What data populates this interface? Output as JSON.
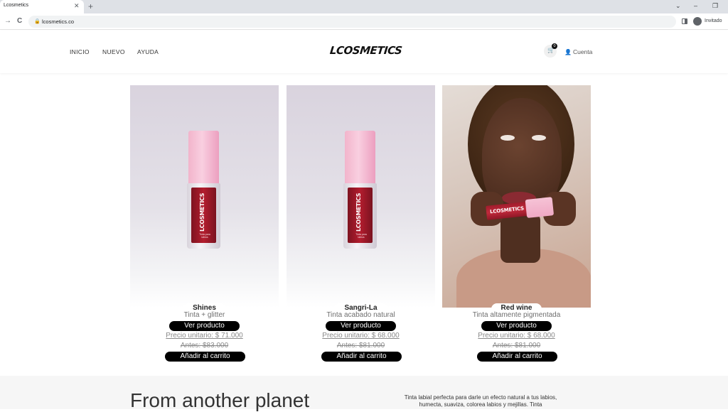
{
  "browser": {
    "tab_title": "Lcosmetics",
    "tab_close": "✕",
    "new_tab": "+",
    "url": "lcosmetics.co",
    "profile_label": "Invitado",
    "back": "→",
    "reload": "C",
    "controls": [
      "⌄",
      "–",
      "❐"
    ]
  },
  "header": {
    "nav": [
      "INICIO",
      "NUEVO",
      "AYUDA"
    ],
    "logo": "LCOSMETICS",
    "cart_count": "0",
    "account_label": "Cuenta"
  },
  "bottle_label": "LCOSMETICS",
  "bottle_small_text": "Tinta para labios",
  "products": [
    {
      "name": "Shines",
      "description": "Tinta + glitter",
      "view_label": "Ver producto",
      "price": "Precio unitario: $ 71.000",
      "before": "Antes: $83.000",
      "add_label": "Añadir al carrito"
    },
    {
      "name": "Sangri-La",
      "description": "Tinta acabado natural",
      "view_label": "Ver producto",
      "price": "Precio unitario: $ 68.000",
      "before": "Antes: $81.000",
      "add_label": "Añadir al carrito"
    },
    {
      "name": "Red wine",
      "description": "Tinta altamente pigmentada",
      "view_label": "Ver producto",
      "price": "Precio unitario: $ 68.000",
      "before": "Antes: $81.000",
      "add_label": "Añadir al carrito"
    }
  ],
  "lower": {
    "title": "From another planet",
    "text": "Tinta labial perfecta para darle un efecto natural a tus labios, humecta, suaviza, colorea labios y mejillas. Tinta"
  },
  "colors": {
    "accent": "#000000",
    "cap_pink": "#f6c3d6",
    "liquid_red": "#b31d2e"
  }
}
